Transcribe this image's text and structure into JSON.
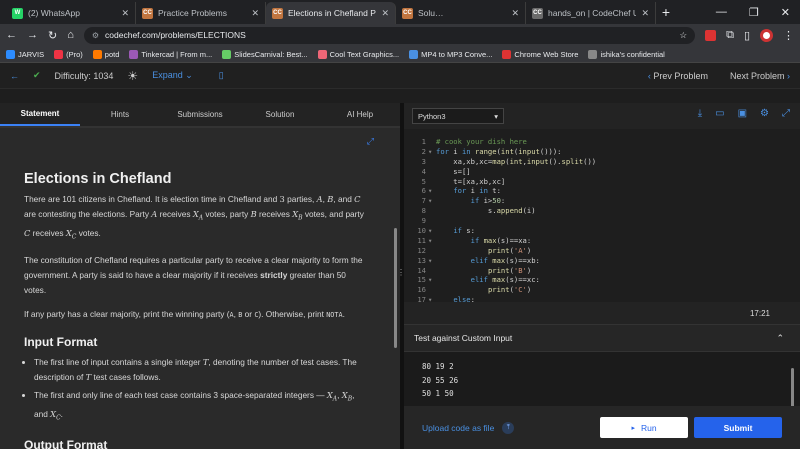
{
  "browser": {
    "tabs": [
      {
        "label": "(2) WhatsApp",
        "icon": "whatsapp-icon",
        "color": "#25d366",
        "glyph": "W"
      },
      {
        "label": "Practice Problems",
        "icon": "codechef-icon",
        "color": "#c1753f",
        "glyph": "CC"
      },
      {
        "label": "Elections in Chefland Practi",
        "icon": "codechef-icon",
        "color": "#c1753f",
        "glyph": "CC"
      },
      {
        "label": "Solu…",
        "icon": "codechef-icon",
        "color": "#c1753f",
        "glyph": "CC"
      },
      {
        "label": "hands_on | CodeChef User",
        "icon": "codechef-icon",
        "color": "#6b6b6b",
        "glyph": "CC"
      }
    ],
    "url": "codechef.com/problems/ELECTIONS",
    "bookmarks": [
      "JARVIS",
      "(Pro)",
      "potd",
      "Tinkercad | From m...",
      "SlidesCarnival: Best...",
      "Cool Text Graphics...",
      "MP4 to MP3 Conve...",
      "Chrome Web Store",
      "ishika's confidential"
    ]
  },
  "topbar": {
    "difficulty": "Difficulty: 1034",
    "expand": "Expand",
    "prev": "Prev Problem",
    "next": "Next Problem"
  },
  "left_tabs": [
    "Statement",
    "Hints",
    "Submissions",
    "Solution",
    "AI Help"
  ],
  "statement": {
    "title": "Elections in Chefland",
    "p1_a": "There are ",
    "p1_n": "101",
    "p1_b": " citizens in Chefland. It is election time in Chefland and ",
    "p1_c": "3",
    "p1_d": " parties, ",
    "p1_A": "A",
    "p1_comma": ", ",
    "p1_B": "B",
    "p1_and": ", and ",
    "p1_C": "C",
    "p1_e": " are contesting the elections. Party ",
    "p1_f": " receives ",
    "p1_XA": "X",
    "p1_sub_A": "A",
    "p1_g": " votes, party ",
    "p1_XB": "X",
    "p1_sub_B": "B",
    "p1_h": " votes, and party ",
    "p1_XC": "X",
    "p1_sub_C": "C",
    "p1_i": " votes.",
    "p2_a": "The constitution of Chefland requires a particular party to receive a clear majority to form the government. A party is said to have a clear majority if it receives ",
    "p2_bold": "strictly",
    "p2_b": " greater than ",
    "p2_c": "50",
    "p2_d": " votes.",
    "p3_a": "If any party has a clear majority, print the winning party (",
    "p3_A": "A",
    "p3_sep1": ", ",
    "p3_B": "B",
    "p3_or": " or ",
    "p3_C": "C",
    "p3_b": "). Otherwise, print ",
    "p3_nota": "NOTA",
    "p3_c": ".",
    "input_heading": "Input Format",
    "li1_a": "The first line of input contains a single integer ",
    "li1_T": "T",
    "li1_b": ", denoting the number of test cases. The description of ",
    "li1_T2": "T",
    "li1_c": " test cases follows.",
    "li2_a": "The first and only line of each test case contains ",
    "li2_3": "3",
    "li2_b": " space-separated integers — ",
    "li2_sep1": ", ",
    "li2_and": ", and ",
    "li2_end": ".",
    "output_heading": "Output Format"
  },
  "editor": {
    "language": "Python3",
    "lines": [
      {
        "n": "1",
        "fold": "",
        "html": "<span class=\"cm\"># cook your dish here</span>"
      },
      {
        "n": "2",
        "fold": "▾",
        "html": "<span class=\"kw\">for</span> i <span class=\"kw\">in</span> <span class=\"fn\">range</span>(<span class=\"fn\">int</span>(<span class=\"fn\">input</span>())):"
      },
      {
        "n": "3",
        "fold": "",
        "html": "    xa,xb,xc=<span class=\"fn\">map</span>(<span class=\"fn\">int</span>,<span class=\"fn\">input</span>().<span class=\"fn\">split</span>())"
      },
      {
        "n": "4",
        "fold": "",
        "html": "    s=[]"
      },
      {
        "n": "5",
        "fold": "",
        "html": "    t=[xa,xb,xc]"
      },
      {
        "n": "6",
        "fold": "▾",
        "html": "    <span class=\"kw\">for</span> i <span class=\"kw\">in</span> t:"
      },
      {
        "n": "7",
        "fold": "▾",
        "html": "        <span class=\"kw\">if</span> i><span class=\"num\">50</span>:"
      },
      {
        "n": "8",
        "fold": "",
        "html": "            s.<span class=\"fn\">append</span>(i)"
      },
      {
        "n": "9",
        "fold": "",
        "html": ""
      },
      {
        "n": "10",
        "fold": "▾",
        "html": "    <span class=\"kw\">if</span> s:"
      },
      {
        "n": "11",
        "fold": "▾",
        "html": "        <span class=\"kw\">if</span> <span class=\"fn\">max</span>(s)==xa:"
      },
      {
        "n": "12",
        "fold": "",
        "html": "            <span class=\"fn\">print</span>(<span class=\"str\">'A'</span>)"
      },
      {
        "n": "13",
        "fold": "▾",
        "html": "        <span class=\"kw\">elif</span> <span class=\"fn\">max</span>(s)==xb:"
      },
      {
        "n": "14",
        "fold": "",
        "html": "            <span class=\"fn\">print</span>(<span class=\"str\">'B'</span>)"
      },
      {
        "n": "15",
        "fold": "▾",
        "html": "        <span class=\"kw\">elif</span> <span class=\"fn\">max</span>(s)==xc:"
      },
      {
        "n": "16",
        "fold": "",
        "html": "            <span class=\"fn\">print</span>(<span class=\"str\">'C'</span>)"
      },
      {
        "n": "17",
        "fold": "▾",
        "html": "    <span class=\"kw\">else</span>:"
      }
    ]
  },
  "timer": "17:21",
  "test": {
    "heading": "Test against Custom Input",
    "lines": [
      "80 19 2",
      "20 55 26",
      "50 1 50"
    ]
  },
  "actions": {
    "upload": "Upload code as file",
    "run": "Run",
    "submit": "Submit"
  }
}
